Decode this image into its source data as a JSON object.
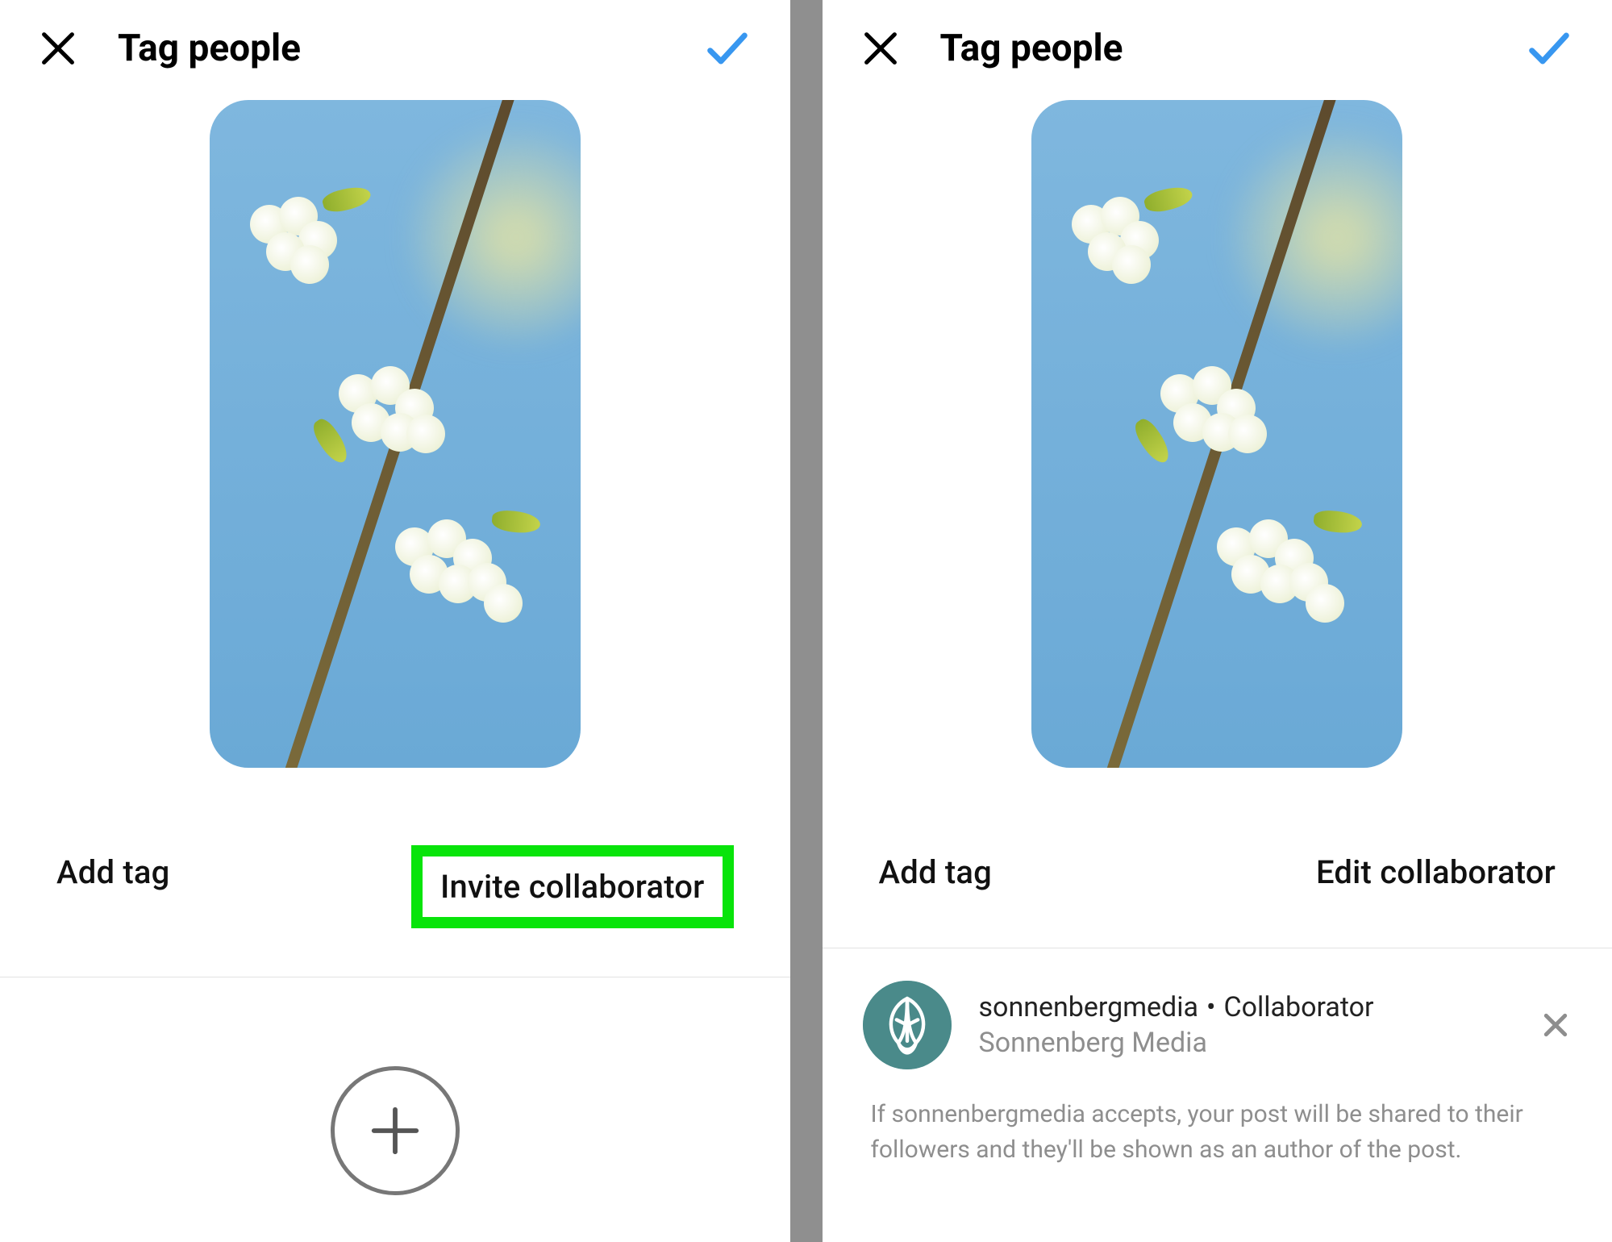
{
  "left": {
    "header": {
      "title": "Tag people"
    },
    "actions": {
      "add_tag": "Add tag",
      "invite_collaborator": "Invite collaborator"
    }
  },
  "right": {
    "header": {
      "title": "Tag people"
    },
    "actions": {
      "add_tag": "Add tag",
      "edit_collaborator": "Edit collaborator"
    },
    "collaborator": {
      "username": "sonnenbergmedia",
      "role": "Collaborator",
      "display_name": "Sonnenberg Media"
    },
    "info": "If sonnenbergmedia accepts, your post will be shared to their followers and they'll be shown as an author of the post."
  },
  "icons": {
    "close": "close-icon",
    "confirm": "checkmark-icon",
    "add": "plus-icon",
    "remove": "close-small-icon",
    "avatar": "leaf-avatar-icon"
  },
  "colors": {
    "accent_blue": "#3897f0",
    "highlight_green": "#08e40a",
    "muted_text": "#8e8e8e"
  }
}
